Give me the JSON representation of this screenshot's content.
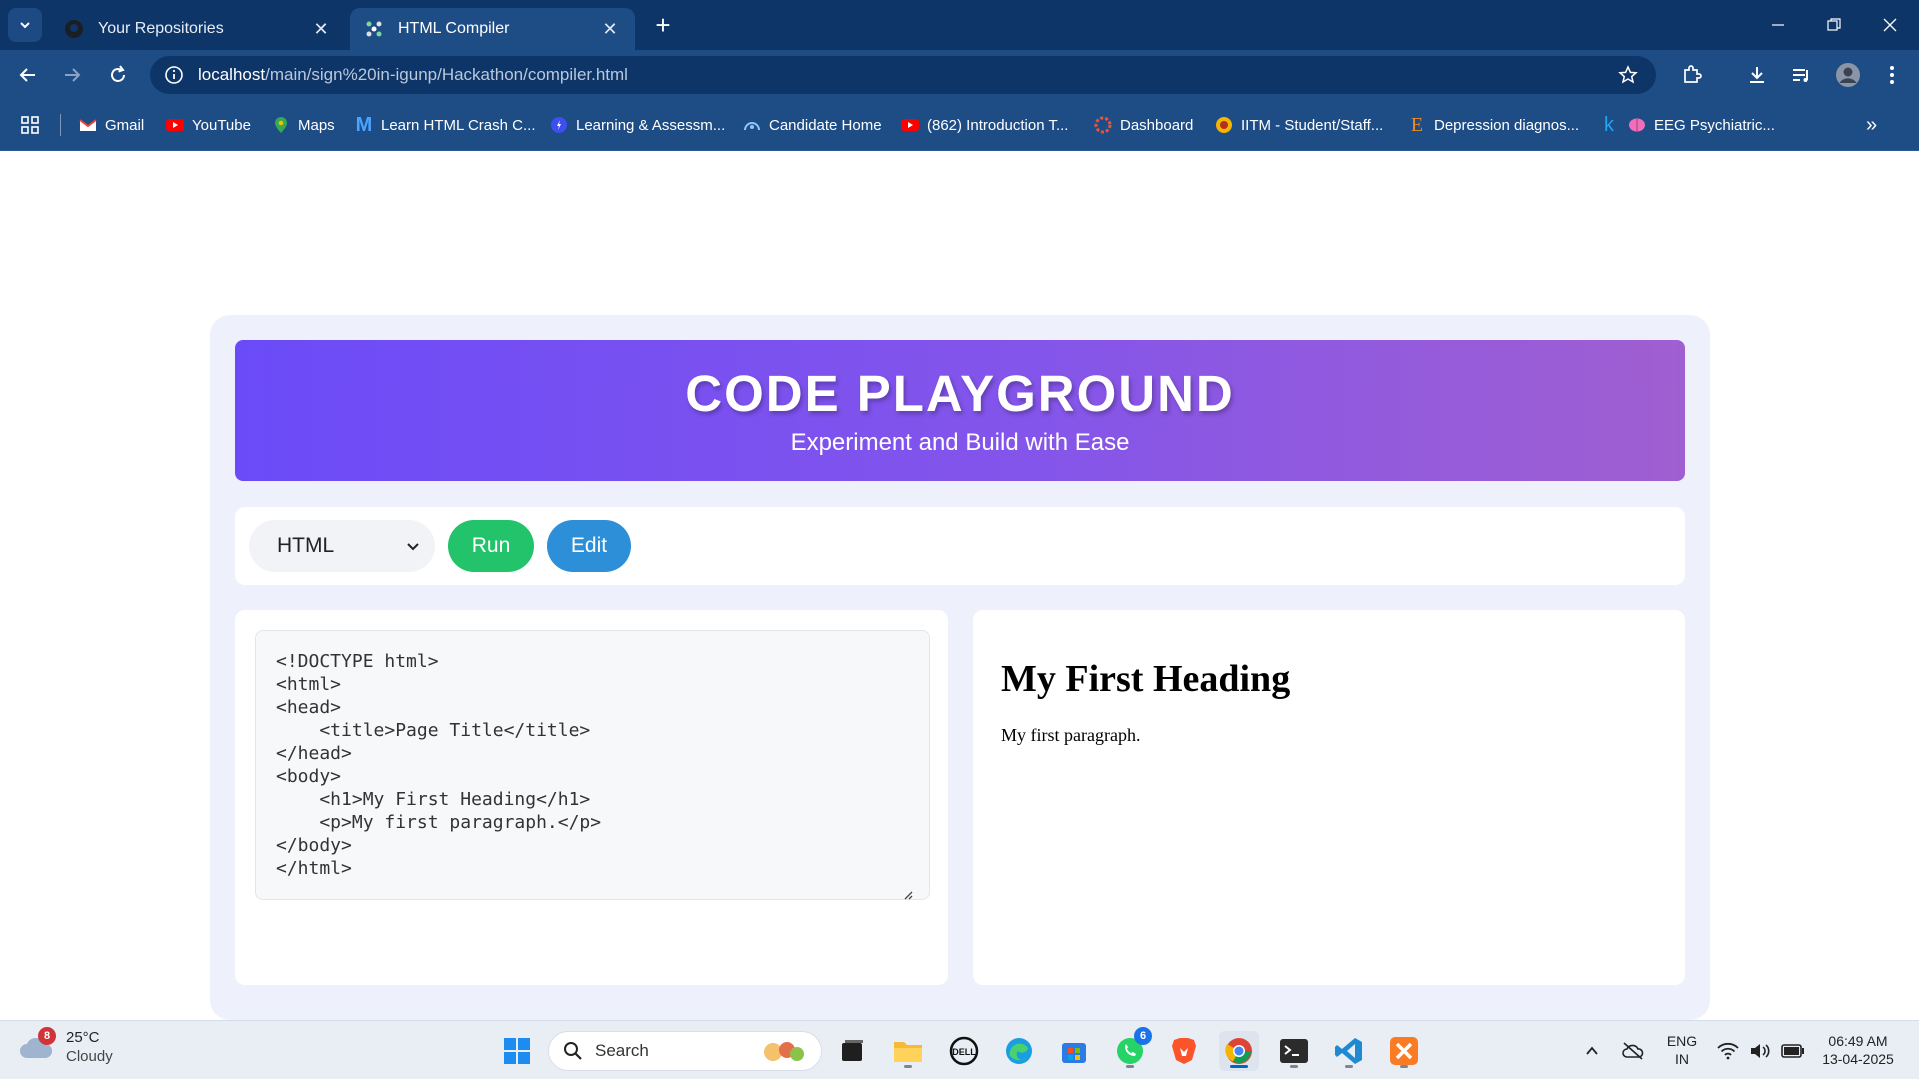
{
  "browser": {
    "tabs": [
      {
        "title": "Your Repositories",
        "active": false,
        "icon": "github-icon"
      },
      {
        "title": "HTML Compiler",
        "active": true,
        "icon": "compiler-icon"
      }
    ],
    "url_host": "localhost",
    "url_path": "/main/sign%20in-igunp/Hackathon/compiler.html",
    "bookmarks": [
      {
        "label": "Gmail",
        "icon": "gmail-icon"
      },
      {
        "label": "YouTube",
        "icon": "youtube-icon"
      },
      {
        "label": "Maps",
        "icon": "maps-icon"
      },
      {
        "label": "Learn HTML Crash C...",
        "icon": "m-icon"
      },
      {
        "label": "Learning & Assessm...",
        "icon": "learning-icon"
      },
      {
        "label": "Candidate Home",
        "icon": "candidate-icon"
      },
      {
        "label": "(862) Introduction T...",
        "icon": "youtube-icon"
      },
      {
        "label": "Dashboard",
        "icon": "dashboard-icon"
      },
      {
        "label": "IITM - Student/Staff...",
        "icon": "iitm-icon"
      },
      {
        "label": "Depression diagnos...",
        "icon": "e-icon"
      },
      {
        "label": "EEG Psychiatric...",
        "icon": "brain-icon"
      }
    ]
  },
  "page": {
    "title": "CODE PLAYGROUND",
    "subtitle": "Experiment and Build with Ease",
    "language": "HTML",
    "run_label": "Run",
    "edit_label": "Edit",
    "code": "<!DOCTYPE html>\n<html>\n<head>\n    <title>Page Title</title>\n</head>\n<body>\n    <h1>My First Heading</h1>\n    <p>My first paragraph.</p>\n</body>\n</html>",
    "preview": {
      "heading": "My First Heading",
      "paragraph": "My first paragraph."
    }
  },
  "taskbar": {
    "weather_badge": "8",
    "temperature": "25°C",
    "weather": "Cloudy",
    "search_placeholder": "Search",
    "whatsapp_badge": "6",
    "lang_line1": "ENG",
    "lang_line2": "IN",
    "time": "06:49 AM",
    "date": "13-04-2025"
  },
  "colors": {
    "header_start": "#6b4bf8",
    "header_end": "#a05fd1",
    "run": "#22c36a",
    "edit": "#2d8fd8",
    "chrome_dark": "#0e3567",
    "chrome": "#1e4d86"
  }
}
